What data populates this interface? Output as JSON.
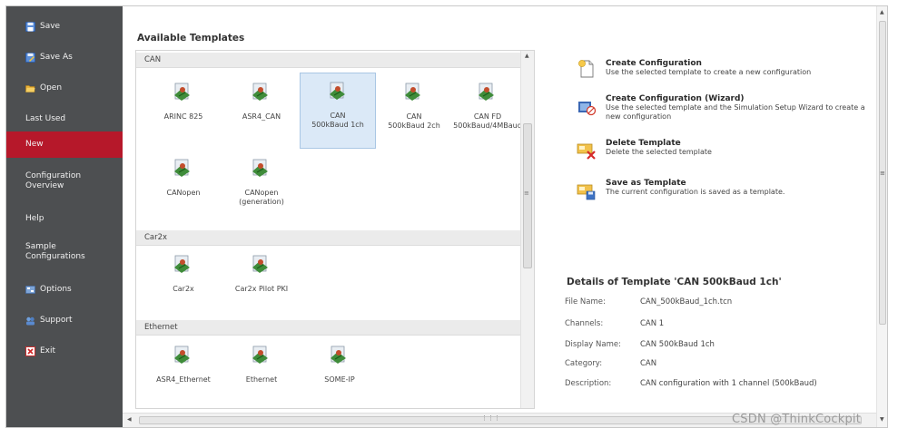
{
  "sidebar": {
    "items": [
      {
        "label": "Save",
        "icon": "save-icon",
        "active": false
      },
      {
        "label": "Save As",
        "icon": "save-as-icon",
        "active": false
      },
      {
        "label": "Open",
        "icon": "folder-open-icon",
        "active": false
      },
      {
        "label": "Last Used",
        "icon": "",
        "active": false
      },
      {
        "label": "New",
        "icon": "",
        "active": true
      },
      {
        "label": "Configuration Overview",
        "icon": "",
        "active": false
      },
      {
        "label": "Help",
        "icon": "",
        "active": false
      },
      {
        "label": "Sample Configurations",
        "icon": "",
        "active": false
      },
      {
        "label": "Options",
        "icon": "options-icon",
        "active": false
      },
      {
        "label": "Support",
        "icon": "support-icon",
        "active": false
      },
      {
        "label": "Exit",
        "icon": "exit-icon",
        "active": false
      }
    ],
    "colors": {
      "background": "#4d4f51",
      "active": "#b6182a",
      "text": "#f0f0f0"
    }
  },
  "templates": {
    "title": "Available Templates",
    "groups": [
      {
        "name": "CAN",
        "items": [
          {
            "label": "ARINC 825",
            "selected": false
          },
          {
            "label": "ASR4_CAN",
            "selected": false
          },
          {
            "label": "CAN 500kBaud 1ch",
            "selected": true
          },
          {
            "label": "CAN 500kBaud 2ch",
            "selected": false
          },
          {
            "label": "CAN FD 500kBaud/4MBaud",
            "selected": false
          },
          {
            "label": "CANopen",
            "selected": false
          },
          {
            "label": "CANopen (generation)",
            "selected": false
          }
        ]
      },
      {
        "name": "Car2x",
        "items": [
          {
            "label": "Car2x",
            "selected": false
          },
          {
            "label": "Car2x Pilot PKI",
            "selected": false
          }
        ]
      },
      {
        "name": "Ethernet",
        "items": [
          {
            "label": "ASR4_Ethernet",
            "selected": false
          },
          {
            "label": "Ethernet",
            "selected": false
          },
          {
            "label": "SOME-IP",
            "selected": false
          }
        ]
      }
    ]
  },
  "actions": {
    "create": {
      "title": "Create Configuration",
      "desc": "Use the selected template to create a new configuration",
      "icon": "new-document-icon"
    },
    "wizard": {
      "title": "Create Configuration (Wizard)",
      "desc": "Use the selected template and the Simulation Setup Wizard to create a new configuration",
      "icon": "wizard-icon"
    },
    "delete": {
      "title": "Delete Template",
      "desc": "Delete the selected template",
      "icon": "delete-template-icon"
    },
    "save": {
      "title": "Save as Template",
      "desc": "The current configuration is saved as a template.",
      "icon": "save-template-icon"
    }
  },
  "details": {
    "title": "Details of Template 'CAN 500kBaud 1ch'",
    "rows": [
      {
        "label": "File Name:",
        "value": "CAN_500kBaud_1ch.tcn"
      },
      {
        "label": "Channels:",
        "value": "CAN 1"
      },
      {
        "label": "Display Name:",
        "value": "CAN 500kBaud 1ch"
      },
      {
        "label": "Category:",
        "value": "CAN"
      },
      {
        "label": "Description:",
        "value": "CAN configuration with 1 channel (500kBaud)"
      }
    ]
  },
  "watermark": "CSDN @ThinkCockpit"
}
